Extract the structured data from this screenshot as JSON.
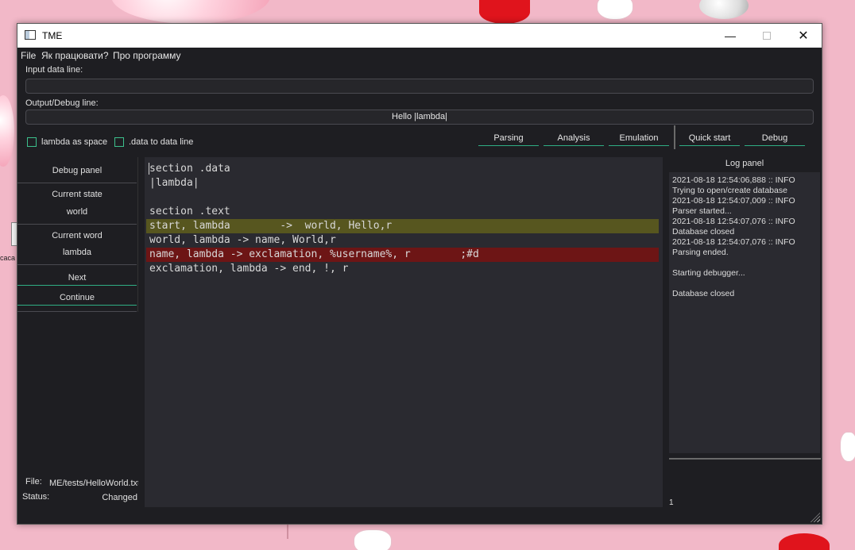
{
  "window": {
    "title": "TME"
  },
  "menu": [
    "File",
    "Як працювати?",
    "Про программу"
  ],
  "input": {
    "label": "Input data line:",
    "value": ""
  },
  "output": {
    "label": "Output/Debug line:",
    "value": "Hello |lambda|"
  },
  "options": {
    "lambda_as_space": "lambda as space",
    "data_to_line": ".data to data line"
  },
  "toolbar": {
    "parsing": "Parsing",
    "analysis": "Analysis",
    "emulation": "Emulation",
    "quick_start": "Quick start",
    "debug": "Debug"
  },
  "debug_panel": {
    "title": "Debug panel",
    "current_state_label": "Current state",
    "current_state_value": "world",
    "current_word_label": "Current word",
    "current_word_value": "lambda",
    "next": "Next",
    "continue": "Continue"
  },
  "footer": {
    "file_label": "File:",
    "file_value": "ME/tests/HelloWorld.txt",
    "status_label": "Status:",
    "status_value": "Changed"
  },
  "editor": {
    "lines": [
      "section .data",
      "|lambda|",
      "",
      "section .text",
      "start, lambda        ->  world, Hello,r",
      "world, lambda -> name, World,r",
      "name, lambda -> exclamation, %username%, r        ;#d",
      "exclamation, lambda -> end, !, r"
    ],
    "highlight_current_line": 5,
    "highlight_breakpoint_line": 7
  },
  "log": {
    "title": "Log panel",
    "lines": [
      "2021-08-18 12:54:06,888 :: INFO",
      "Trying to open/create database",
      "2021-08-18 12:54:07,009 :: INFO",
      "Parser started...",
      "2021-08-18 12:54:07,076 :: INFO",
      "Database closed",
      "2021-08-18 12:54:07,076 :: INFO",
      "Parsing ended.",
      "",
      "Starting debugger...",
      "",
      "Database closed"
    ],
    "counter": "1"
  },
  "desktop": {
    "icon_label": "caca"
  },
  "colors": {
    "accent": "#2fae84",
    "current_line": "#57561f",
    "breakpoint_line": "#6d1515",
    "desktop_bg": "#f2b8c8"
  }
}
